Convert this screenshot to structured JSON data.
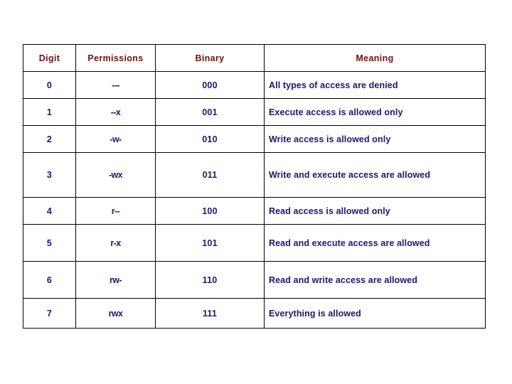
{
  "page": {
    "background_color": "#ffffff",
    "header_text_color": "#6B1212",
    "body_text_color": "#191970",
    "border_color": "#000000"
  },
  "table": {
    "headers": {
      "digit": "Digit",
      "permissions": "Permissions",
      "binary": "Binary",
      "meaning": "Meaning"
    },
    "rows": [
      {
        "digit": "0",
        "permissions": "---",
        "binary": "000",
        "meaning": "All types of access are denied"
      },
      {
        "digit": "1",
        "permissions": "--x",
        "binary": "001",
        "meaning": "Execute access is allowed only"
      },
      {
        "digit": "2",
        "permissions": "-w-",
        "binary": "010",
        "meaning": "Write access is allowed only"
      },
      {
        "digit": "3",
        "permissions": "-wx",
        "binary": "011",
        "meaning": "Write and execute access are allowed"
      },
      {
        "digit": "4",
        "permissions": "r--",
        "binary": "100",
        "meaning": "Read access is allowed only"
      },
      {
        "digit": "5",
        "permissions": "r-x",
        "binary": "101",
        "meaning": "Read and execute access are allowed"
      },
      {
        "digit": "6",
        "permissions": "rw-",
        "binary": "110",
        "meaning": "Read and write access are allowed"
      },
      {
        "digit": "7",
        "permissions": "rwx",
        "binary": "111",
        "meaning": "Everything is allowed"
      }
    ]
  }
}
